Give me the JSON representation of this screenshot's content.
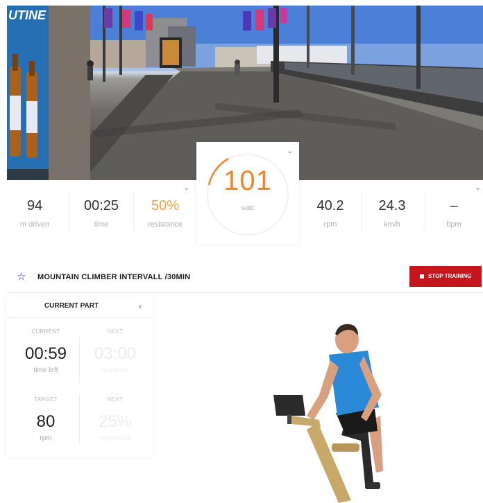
{
  "scene": {
    "billboard_text": "UTINE"
  },
  "stats": {
    "distance": {
      "value": "94",
      "label": "m driven"
    },
    "time": {
      "value": "00:25",
      "label": "time"
    },
    "resistance": {
      "value": "50%",
      "label": "resistance"
    },
    "watt": {
      "value": "101",
      "label": "watt"
    },
    "rpm": {
      "value": "40.2",
      "label": "rpm"
    },
    "speed": {
      "value": "24.3",
      "label": "km/h"
    },
    "heart": {
      "value": "–",
      "label": "bpm"
    }
  },
  "workout": {
    "title": "MOUNTAIN CLIMBER INTERVALL /30MIN",
    "stop_label": "STOP TRAINING"
  },
  "current_part": {
    "title": "CURRENT PART",
    "current_time": {
      "caption": "CURRENT",
      "value": "00:59",
      "label": "time left"
    },
    "next_time": {
      "caption": "NEXT",
      "value": "03:00",
      "label": "duration"
    },
    "target_rpm": {
      "caption": "TARGET",
      "value": "80",
      "label": "rpm"
    },
    "next_resistance": {
      "caption": "NEXT",
      "value": "25%",
      "label": "resistance"
    }
  },
  "colors": {
    "accent_orange": "#f0862c",
    "resistance_yellow": "#f0a23a",
    "stop_red": "#c4161c",
    "shirt_blue": "#2a8ad8"
  }
}
